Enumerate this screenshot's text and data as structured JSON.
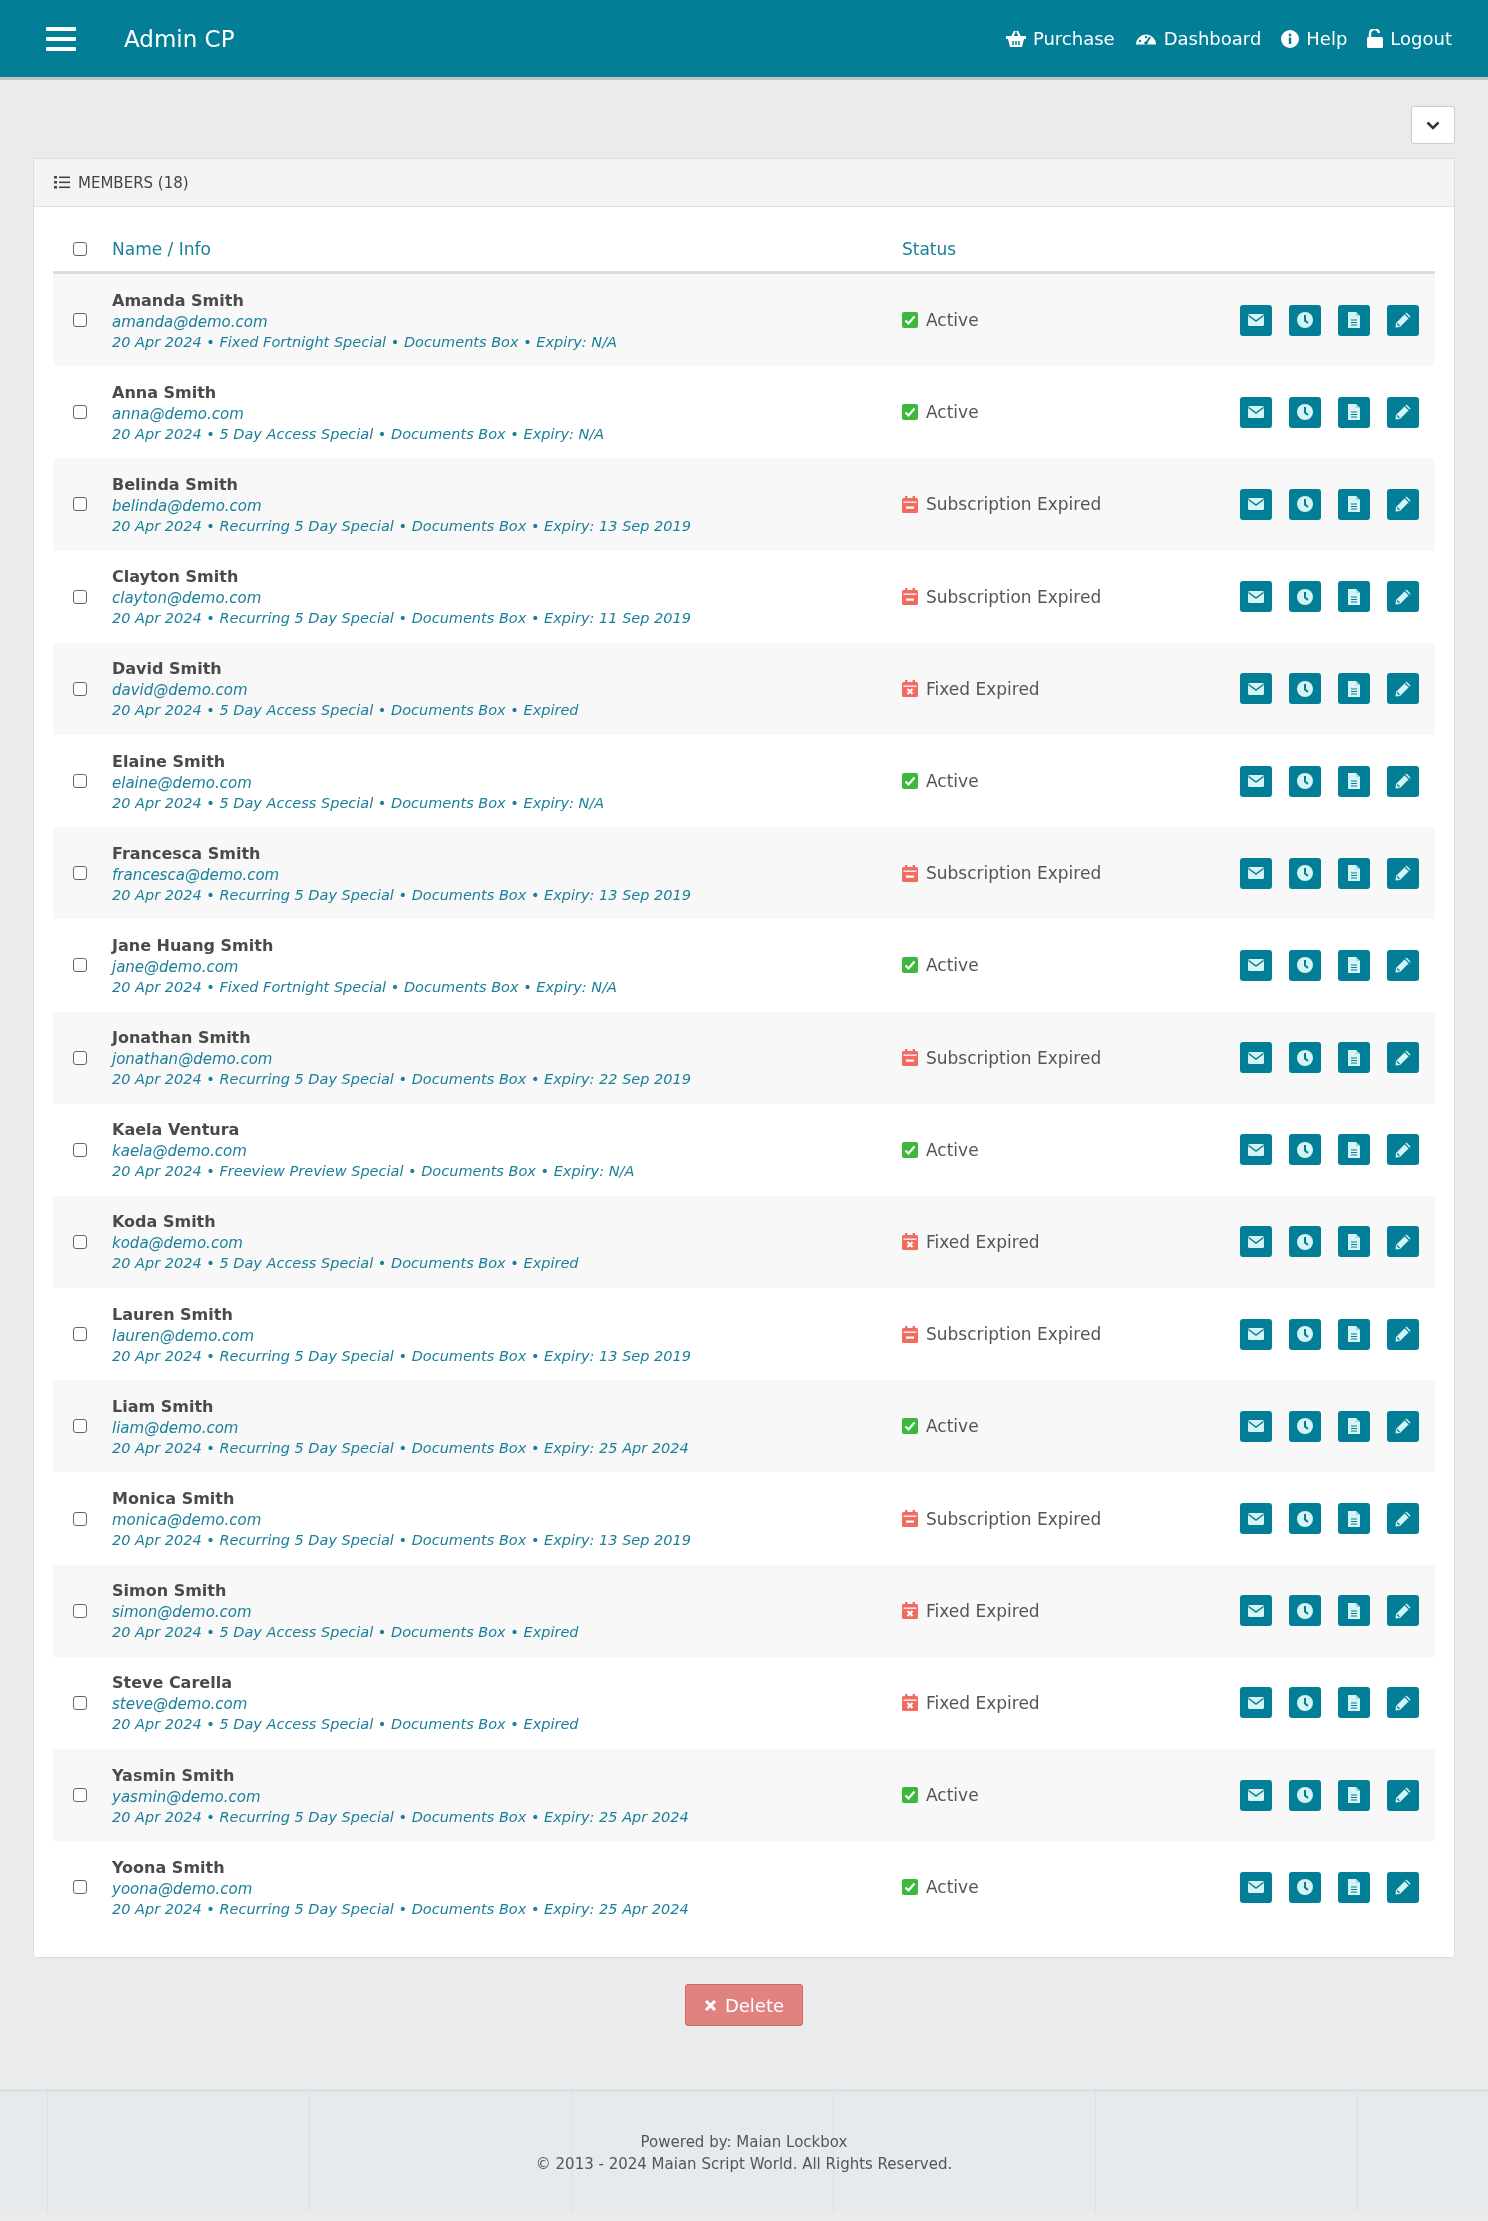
{
  "header": {
    "title": "Admin CP",
    "nav": [
      {
        "kind": "basket",
        "label": "Purchase"
      },
      {
        "kind": "gauge",
        "label": "Dashboard"
      },
      {
        "kind": "info",
        "label": "Help"
      },
      {
        "kind": "unlock",
        "label": "Logout"
      }
    ]
  },
  "panel": {
    "title": "MEMBERS (18)"
  },
  "table": {
    "select_all_checked": false,
    "columns": [
      "Name / Info",
      "Status"
    ],
    "rows": [
      {
        "name": "Amanda Smith",
        "email": "amanda@demo.com",
        "info": "20 Apr 2024 • Fixed Fortnight Special • Documents Box • Expiry: N/A",
        "status": "Active",
        "kind": "active",
        "checked": false
      },
      {
        "name": "Anna Smith",
        "email": "anna@demo.com",
        "info": "20 Apr 2024 • 5 Day Access Special • Documents Box • Expiry: N/A",
        "status": "Active",
        "kind": "active",
        "checked": false
      },
      {
        "name": "Belinda Smith",
        "email": "belinda@demo.com",
        "info": "20 Apr 2024 • Recurring 5 Day Special • Documents Box • Expiry: 13 Sep 2019",
        "status": "Subscription Expired",
        "kind": "subscription_expired",
        "checked": false
      },
      {
        "name": "Clayton Smith",
        "email": "clayton@demo.com",
        "info": "20 Apr 2024 • Recurring 5 Day Special • Documents Box • Expiry: 11 Sep 2019",
        "status": "Subscription Expired",
        "kind": "subscription_expired",
        "checked": false
      },
      {
        "name": "David Smith",
        "email": "david@demo.com",
        "info": "20 Apr 2024 • 5 Day Access Special • Documents Box • Expired",
        "status": "Fixed Expired",
        "kind": "fixed_expired",
        "checked": false
      },
      {
        "name": "Elaine Smith",
        "email": "elaine@demo.com",
        "info": "20 Apr 2024 • 5 Day Access Special • Documents Box • Expiry: N/A",
        "status": "Active",
        "kind": "active",
        "checked": false
      },
      {
        "name": "Francesca Smith",
        "email": "francesca@demo.com",
        "info": "20 Apr 2024 • Recurring 5 Day Special • Documents Box • Expiry: 13 Sep 2019",
        "status": "Subscription Expired",
        "kind": "subscription_expired",
        "checked": false
      },
      {
        "name": "Jane Huang Smith",
        "email": "jane@demo.com",
        "info": "20 Apr 2024 • Fixed Fortnight Special • Documents Box • Expiry: N/A",
        "status": "Active",
        "kind": "active",
        "checked": false
      },
      {
        "name": "Jonathan Smith",
        "email": "jonathan@demo.com",
        "info": "20 Apr 2024 • Recurring 5 Day Special • Documents Box • Expiry: 22 Sep 2019",
        "status": "Subscription Expired",
        "kind": "subscription_expired",
        "checked": false
      },
      {
        "name": "Kaela Ventura",
        "email": "kaela@demo.com",
        "info": "20 Apr 2024 • Freeview Preview Special • Documents Box • Expiry: N/A",
        "status": "Active",
        "kind": "active",
        "checked": false
      },
      {
        "name": "Koda Smith",
        "email": "koda@demo.com",
        "info": "20 Apr 2024 • 5 Day Access Special • Documents Box • Expired",
        "status": "Fixed Expired",
        "kind": "fixed_expired",
        "checked": false
      },
      {
        "name": "Lauren Smith",
        "email": "lauren@demo.com",
        "info": "20 Apr 2024 • Recurring 5 Day Special • Documents Box • Expiry: 13 Sep 2019",
        "status": "Subscription Expired",
        "kind": "subscription_expired",
        "checked": false
      },
      {
        "name": "Liam Smith",
        "email": "liam@demo.com",
        "info": "20 Apr 2024 • Recurring 5 Day Special • Documents Box • Expiry: 25 Apr 2024",
        "status": "Active",
        "kind": "active",
        "checked": false
      },
      {
        "name": "Monica Smith",
        "email": "monica@demo.com",
        "info": "20 Apr 2024 • Recurring 5 Day Special • Documents Box • Expiry: 13 Sep 2019",
        "status": "Subscription Expired",
        "kind": "subscription_expired",
        "checked": false
      },
      {
        "name": "Simon Smith",
        "email": "simon@demo.com",
        "info": "20 Apr 2024 • 5 Day Access Special • Documents Box • Expired",
        "status": "Fixed Expired",
        "kind": "fixed_expired",
        "checked": false
      },
      {
        "name": "Steve Carella",
        "email": "steve@demo.com",
        "info": "20 Apr 2024 • 5 Day Access Special • Documents Box • Expired",
        "status": "Fixed Expired",
        "kind": "fixed_expired",
        "checked": false
      },
      {
        "name": "Yasmin Smith",
        "email": "yasmin@demo.com",
        "info": "20 Apr 2024 • Recurring 5 Day Special • Documents Box • Expiry: 25 Apr 2024",
        "status": "Active",
        "kind": "active",
        "checked": false
      },
      {
        "name": "Yoona Smith",
        "email": "yoona@demo.com",
        "info": "20 Apr 2024 • Recurring 5 Day Special • Documents Box • Expiry: 25 Apr 2024",
        "status": "Active",
        "kind": "active",
        "checked": false
      }
    ]
  },
  "delete_button": "Delete",
  "footer": {
    "powered_by": "Powered by: Maian Lockbox",
    "copyright": "© 2013 - 2024 Maian Script World. All Rights Reserved."
  }
}
